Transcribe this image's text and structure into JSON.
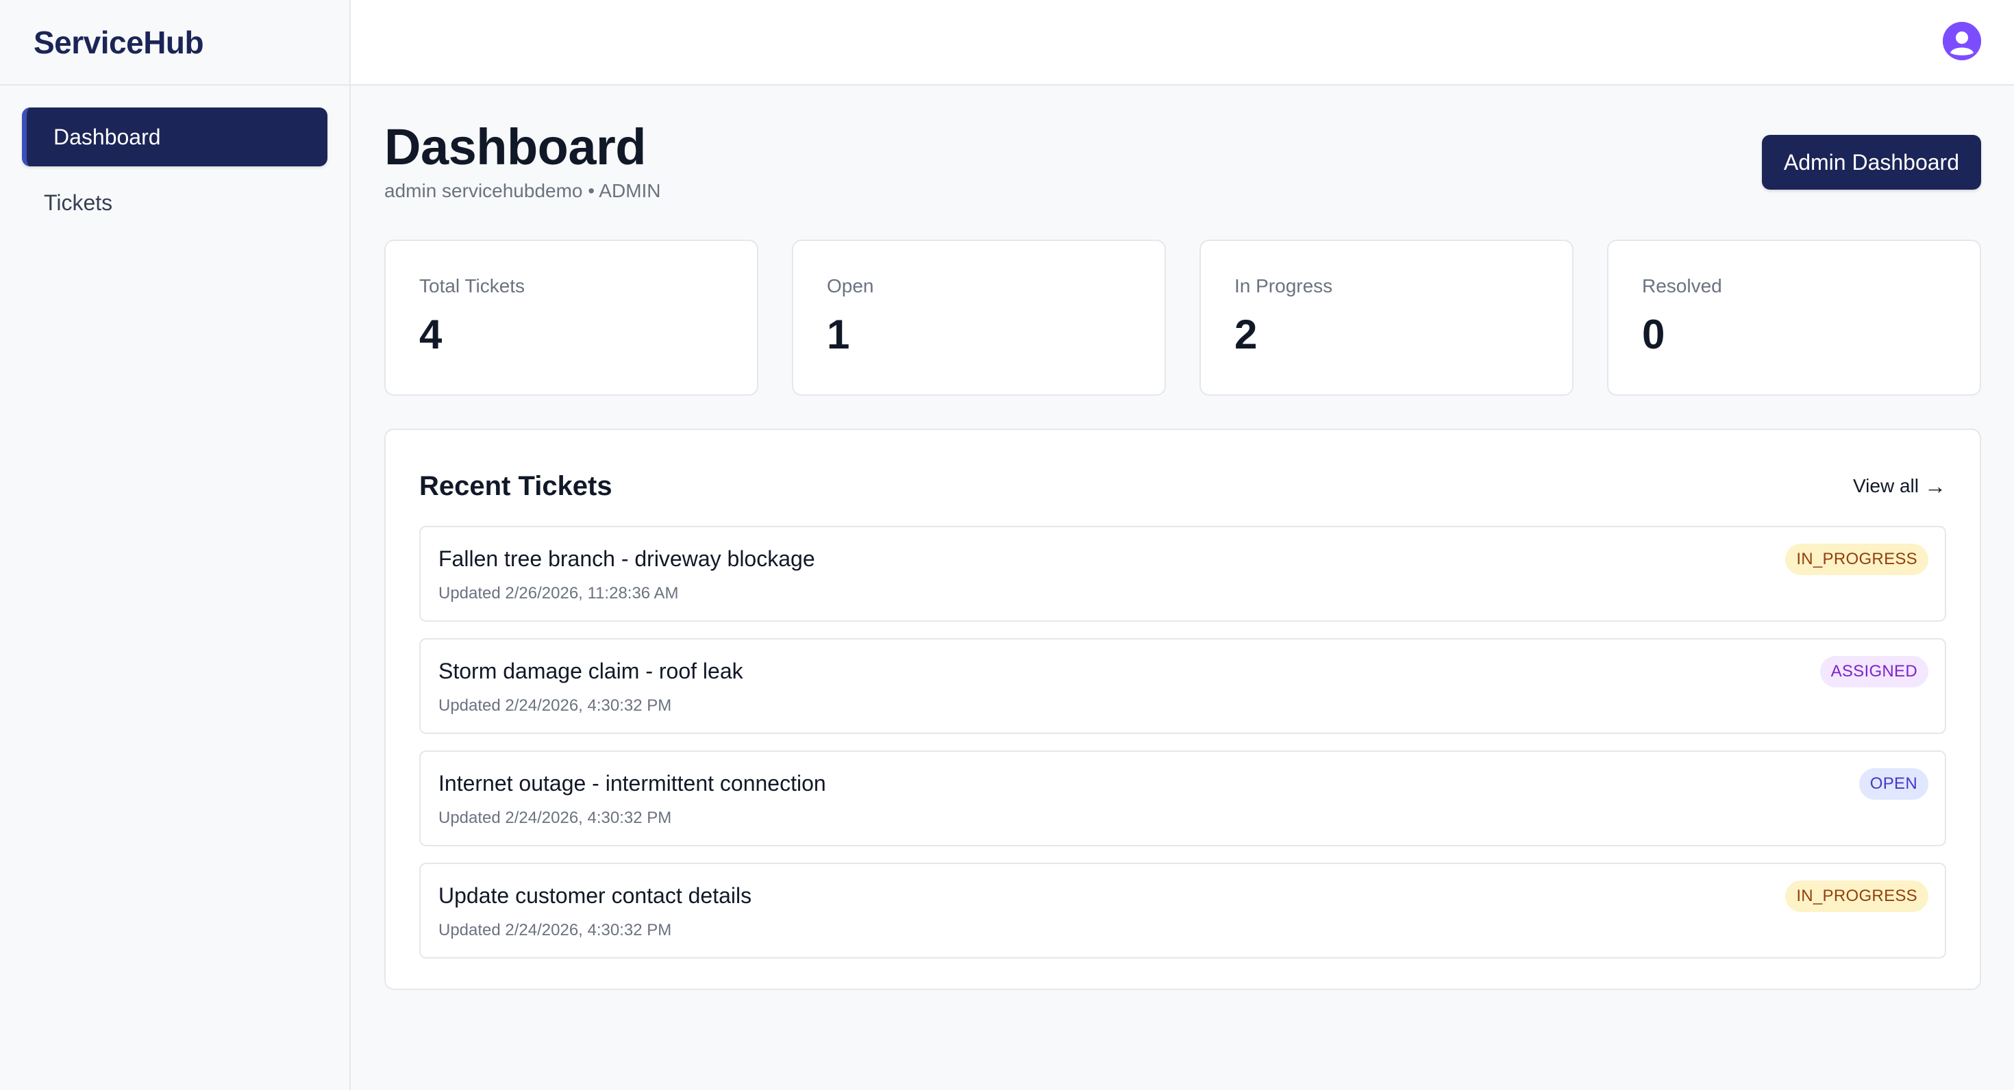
{
  "app": {
    "brand": "ServiceHub"
  },
  "sidebar": {
    "items": [
      {
        "label": "Dashboard",
        "active": true
      },
      {
        "label": "Tickets",
        "active": false
      }
    ]
  },
  "topbar": {
    "avatar_icon": "user-avatar-icon"
  },
  "header": {
    "title": "Dashboard",
    "subtitle": "admin servicehubdemo • ADMIN",
    "admin_button": "Admin Dashboard"
  },
  "stats": [
    {
      "label": "Total Tickets",
      "value": "4"
    },
    {
      "label": "Open",
      "value": "1"
    },
    {
      "label": "In Progress",
      "value": "2"
    },
    {
      "label": "Resolved",
      "value": "0"
    }
  ],
  "recent": {
    "title": "Recent Tickets",
    "view_all": "View all",
    "view_all_arrow": "→",
    "tickets": [
      {
        "title": "Fallen tree branch - driveway blockage",
        "updated": "Updated 2/26/2026, 11:28:36 AM",
        "status": "IN_PROGRESS"
      },
      {
        "title": "Storm damage claim - roof leak",
        "updated": "Updated 2/24/2026, 4:30:32 PM",
        "status": "ASSIGNED"
      },
      {
        "title": "Internet outage - intermittent connection",
        "updated": "Updated 2/24/2026, 4:30:32 PM",
        "status": "OPEN"
      },
      {
        "title": "Update customer contact details",
        "updated": "Updated 2/24/2026, 4:30:32 PM",
        "status": "IN_PROGRESS"
      }
    ]
  },
  "colors": {
    "brand": "#1b2557",
    "in_progress_bg": "#fef3c7",
    "assigned_bg": "#f3e8ff",
    "open_bg": "#e0e7ff"
  }
}
